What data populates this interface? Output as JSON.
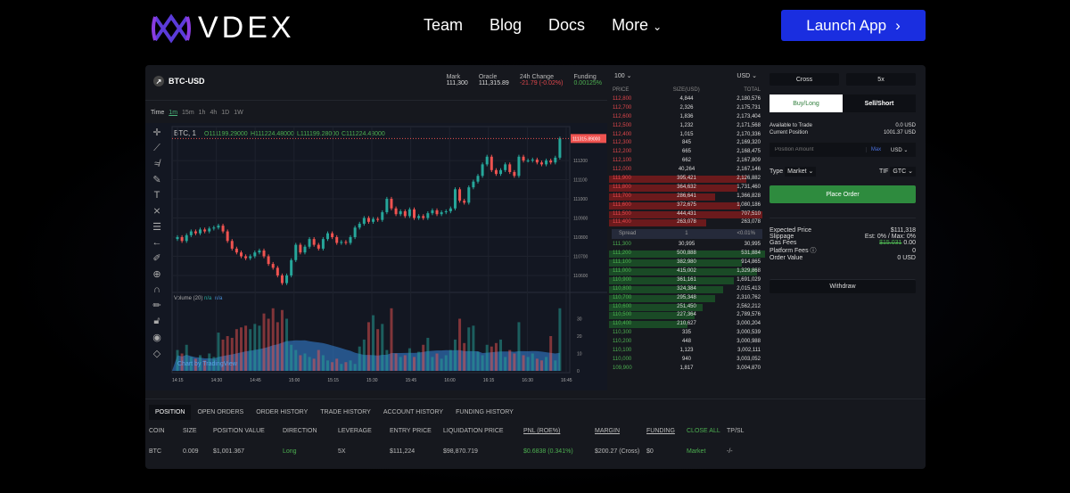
{
  "header": {
    "brand": "VDEX",
    "nav": [
      "Team",
      "Blog",
      "Docs",
      "More"
    ],
    "launch": "Launch App"
  },
  "market": {
    "symbol": "BTC-USD",
    "stats": [
      {
        "label": "Mark",
        "value": "111,300"
      },
      {
        "label": "Oracle",
        "value": "111,315.89"
      },
      {
        "label": "24h Change",
        "value": "-21.79 (-0.02%)"
      },
      {
        "label": "Funding",
        "value": "0.00125%"
      }
    ]
  },
  "timeframes": {
    "label": "Time",
    "items": [
      "1m",
      "15m",
      "1h",
      "4h",
      "1D",
      "1W"
    ]
  },
  "chart": {
    "legend_symbol": "BTC, 1",
    "o": "O111199.29000",
    "h": "H111224.48000",
    "l": "L111199.28000",
    "c": "C111224.48000",
    "last_price": "111315.89000",
    "volume_label": "Volume (20)",
    "na1": "n/a",
    "na2": "n/a",
    "watermark": "Chart by TradingView"
  },
  "chart_data": {
    "type": "candlestick",
    "y_ticks": [
      111200,
      111100,
      111000,
      110900,
      110800,
      110700,
      110600
    ],
    "volume_ticks": [
      0,
      10,
      20,
      30
    ],
    "x_ticks": [
      "14:15",
      "14:30",
      "14:45",
      "15:00",
      "15:15",
      "15:30",
      "15:45",
      "16:00",
      "16:15",
      "16:30",
      "16:45"
    ],
    "closes": [
      110800,
      110780,
      110810,
      110830,
      110820,
      110840,
      110830,
      110845,
      110850,
      110860,
      110830,
      110780,
      110740,
      110720,
      110700,
      110690,
      110700,
      110720,
      110730,
      110700,
      110660,
      110640,
      110600,
      110560,
      110600,
      110680,
      110760,
      110720,
      110750,
      110790,
      110760,
      110740,
      110790,
      110820,
      110800,
      110770,
      110775,
      110770,
      110800,
      110850,
      110870,
      110900,
      110880,
      110895,
      110890,
      110930,
      111000,
      110950,
      110920,
      110935,
      110910,
      110945,
      110900,
      110910,
      110900,
      110925,
      110940,
      110920,
      110930,
      110935,
      110950,
      111050,
      110990,
      110980,
      111060,
      111090,
      111120,
      111180,
      111220,
      111150,
      111130,
      111150,
      111180,
      111140,
      111120,
      111220,
      111200,
      111200,
      111205,
      111190,
      111180,
      111200,
      111190,
      111215,
      111315
    ],
    "volumes": [
      12,
      10,
      15,
      8,
      7,
      9,
      6,
      10,
      8,
      22,
      18,
      20,
      19,
      24,
      25,
      26,
      24,
      27,
      26,
      33,
      30,
      36,
      28,
      35,
      30,
      15,
      12,
      9,
      10,
      8,
      7,
      12,
      9,
      6,
      5,
      7,
      4,
      5,
      6,
      4,
      14,
      18,
      28,
      32,
      24,
      27,
      12,
      36,
      10,
      8,
      9,
      13,
      8,
      11,
      15,
      19,
      8,
      10,
      7,
      9,
      12,
      18,
      30,
      16,
      25,
      26,
      11,
      9,
      15,
      14,
      16,
      18,
      8,
      12,
      10,
      28,
      9,
      8,
      10,
      7,
      6,
      8,
      20,
      6,
      36
    ]
  },
  "orderbook": {
    "depth": "100",
    "currency": "USD",
    "cols": [
      "PRICE",
      "SIZE(USD)",
      "TOTAL"
    ],
    "asks": [
      [
        "112,800",
        "4,844",
        "2,180,576",
        0
      ],
      [
        "112,700",
        "2,326",
        "2,175,731",
        0
      ],
      [
        "112,600",
        "1,836",
        "2,173,404",
        0
      ],
      [
        "112,500",
        "1,232",
        "2,171,568",
        0
      ],
      [
        "112,400",
        "1,015",
        "2,170,336",
        0
      ],
      [
        "112,300",
        "845",
        "2,169,320",
        0
      ],
      [
        "112,200",
        "665",
        "2,168,475",
        0
      ],
      [
        "112,100",
        "662",
        "2,167,809",
        0
      ],
      [
        "112,000",
        "40,264",
        "2,167,146",
        0
      ],
      [
        "111,900",
        "395,421",
        "2,126,882",
        0.88
      ],
      [
        "111,800",
        "364,632",
        "1,731,460",
        0.82
      ],
      [
        "111,700",
        "286,641",
        "1,366,828",
        0.68
      ],
      [
        "111,600",
        "372,675",
        "1,080,186",
        0.84
      ],
      [
        "111,500",
        "444,431",
        "707,510",
        0.98
      ],
      [
        "111,400",
        "263,078",
        "263,078",
        0.62
      ]
    ],
    "spread": {
      "label": "Spread",
      "value": "1",
      "pct": "<0.01%"
    },
    "bids": [
      [
        "111,300",
        "30,995",
        "30,995",
        0
      ],
      [
        "111,200",
        "500,888",
        "531,884",
        1
      ],
      [
        "111,100",
        "382,980",
        "914,865",
        0.85
      ],
      [
        "111,000",
        "415,002",
        "1,329,868",
        0.95
      ],
      [
        "110,900",
        "361,161",
        "1,691,029",
        0.8
      ],
      [
        "110,800",
        "324,384",
        "2,015,413",
        0.73
      ],
      [
        "110,700",
        "295,348",
        "2,310,762",
        0.68
      ],
      [
        "110,600",
        "251,450",
        "2,562,212",
        0.6
      ],
      [
        "110,500",
        "227,364",
        "2,789,576",
        0.55
      ],
      [
        "110,400",
        "210,627",
        "3,000,204",
        0.5
      ],
      [
        "110,300",
        "335",
        "3,000,539",
        0
      ],
      [
        "110,200",
        "448",
        "3,000,988",
        0
      ],
      [
        "110,100",
        "1,123",
        "3,002,111",
        0
      ],
      [
        "110,000",
        "940",
        "3,003,052",
        0
      ],
      [
        "109,900",
        "1,817",
        "3,004,870",
        0
      ]
    ]
  },
  "order": {
    "margin": "Cross",
    "leverage": "5x",
    "buy": "Buy/Long",
    "sell": "Sell/Short",
    "available_label": "Available to Trade",
    "available": "0.0 USD",
    "position_label": "Current Position",
    "position": "1001.37 USD",
    "amount_placeholder": "Position Amount",
    "max": "Max",
    "unit": "USD",
    "type_label": "Type",
    "type": "Market",
    "tif_label": "TIF",
    "tif": "GTC",
    "place": "Place Order",
    "summary": [
      {
        "label": "Expected Price",
        "value": "$111,318"
      },
      {
        "label": "Slippage",
        "value": "Est: 0% / Max: 0%"
      },
      {
        "label": "Gas Fees",
        "strike": "$15.031",
        "value": "0.00"
      },
      {
        "label": "Platform Fees",
        "value": "0"
      },
      {
        "label": "Order Value",
        "value": "0 USD"
      }
    ],
    "withdraw": "Withdraw"
  },
  "positions": {
    "tabs": [
      "POSITION",
      "OPEN ORDERS",
      "ORDER HISTORY",
      "TRADE HISTORY",
      "ACCOUNT HISTORY",
      "FUNDING HISTORY"
    ],
    "cols": [
      "COIN",
      "SIZE",
      "POSITION VALUE",
      "DIRECTION",
      "LEVERAGE",
      "ENTRY PRICE",
      "LIQUIDATION PRICE",
      "PNL (ROE%)",
      "MARGIN",
      "FUNDING",
      "CLOSE ALL",
      "TP/SL"
    ],
    "row": [
      "BTC",
      "0.009",
      "$1,001.367",
      "Long",
      "5X",
      "$111,224",
      "$98,870.719",
      "$0.6838 (0.341%)",
      "$200.27 (Cross)",
      "$0",
      "Market",
      "-/-"
    ]
  },
  "colors": {
    "up": "#26a69a",
    "down": "#ef5350",
    "accent": "#1a2ee0",
    "buy": "#2e7d3a"
  }
}
